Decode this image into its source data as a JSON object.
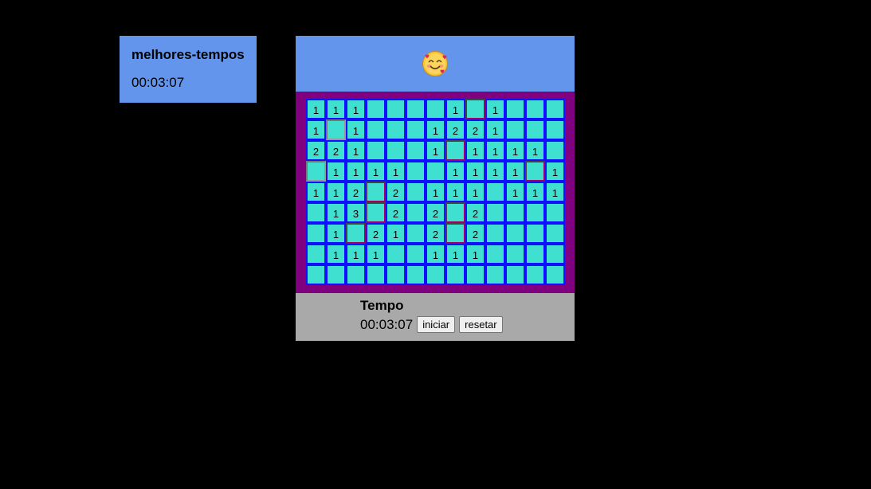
{
  "best_times": {
    "title": "melhores-tempos",
    "entries": [
      "00:03:07"
    ]
  },
  "header": {
    "face_icon": "smiling-face-with-hearts"
  },
  "board": {
    "rows": [
      [
        "1",
        "1",
        "1",
        "",
        "",
        "",
        "",
        "1",
        "#",
        "1",
        "",
        "",
        ""
      ],
      [
        "1",
        "*",
        "1",
        "",
        "",
        "",
        "1",
        "2",
        "2",
        "1",
        "",
        "",
        ""
      ],
      [
        "2",
        "2",
        "1",
        "",
        "",
        "",
        "1",
        "#",
        "1",
        "1",
        "1",
        "1",
        ""
      ],
      [
        "*",
        "1",
        "1",
        "1",
        "1",
        "",
        "",
        "1",
        "1",
        "1",
        "1",
        "#",
        "1"
      ],
      [
        "1",
        "1",
        "2",
        "#",
        "2",
        "",
        "1",
        "1",
        "1",
        "",
        "1",
        "1",
        "1"
      ],
      [
        "",
        "1",
        "3",
        "#",
        "2",
        "",
        "2",
        "#",
        "2",
        "",
        "",
        "",
        ""
      ],
      [
        "",
        "1",
        "#",
        "2",
        "1",
        "",
        "2",
        "#",
        "2",
        "",
        "",
        "",
        ""
      ],
      [
        "",
        "1",
        "1",
        "1",
        "",
        "",
        "1",
        "1",
        "1",
        "",
        "",
        "",
        ""
      ],
      [
        "",
        "",
        "",
        "",
        "",
        "",
        "",
        "",
        "",
        "",
        "",
        "",
        ""
      ]
    ]
  },
  "timer": {
    "label": "Tempo",
    "value": "00:03:07",
    "start_label": "iniciar",
    "reset_label": "resetar"
  },
  "colors": {
    "page_bg": "#000000",
    "panel_bg": "#6495ed",
    "board_bg": "#800080",
    "cell_bg": "#40e0d0",
    "cell_border": "#1010ff",
    "footer_bg": "#a9a9a9"
  }
}
